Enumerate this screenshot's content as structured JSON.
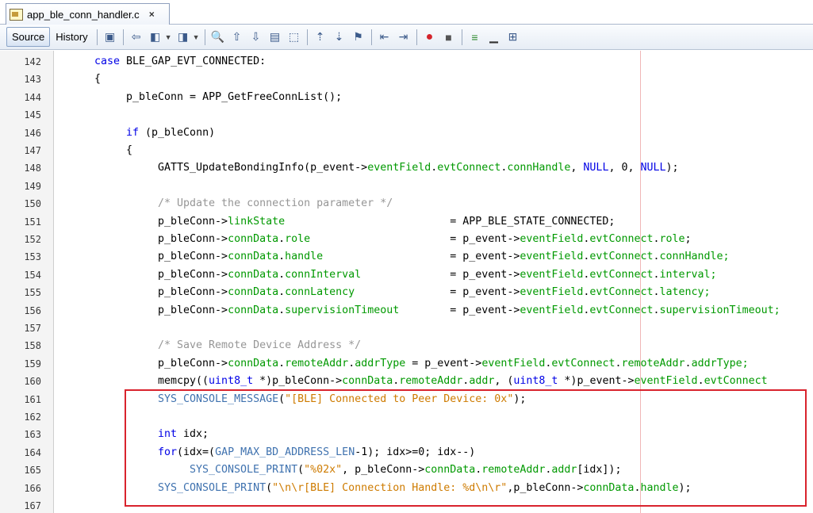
{
  "tab": {
    "filename": "app_ble_conn_handler.c",
    "close": "×"
  },
  "toolbar": {
    "source": "Source",
    "history": "History"
  },
  "line_numbers": [
    "142",
    "143",
    "144",
    "145",
    "146",
    "147",
    "148",
    "149",
    "150",
    "151",
    "152",
    "153",
    "154",
    "155",
    "156",
    "157",
    "158",
    "159",
    "160",
    "161",
    "162",
    "163",
    "164",
    "165",
    "166",
    "167"
  ],
  "lines": [
    {
      "indent": 4,
      "tokens": [
        {
          "t": "case ",
          "c": "kw"
        },
        {
          "t": "BLE_GAP_EVT_CONNECTED:"
        }
      ]
    },
    {
      "indent": 4,
      "tokens": [
        {
          "t": "{"
        }
      ]
    },
    {
      "indent": 8,
      "tokens": [
        {
          "t": "p_bleConn = APP_GetFreeConnList();"
        }
      ]
    },
    {
      "indent": 0,
      "tokens": []
    },
    {
      "indent": 8,
      "tokens": [
        {
          "t": "if",
          "c": "kw"
        },
        {
          "t": " (p_bleConn)"
        }
      ]
    },
    {
      "indent": 8,
      "tokens": [
        {
          "t": "{"
        }
      ]
    },
    {
      "indent": 12,
      "tokens": [
        {
          "t": "GATTS_UpdateBondingInfo(p_event->"
        },
        {
          "t": "eventField",
          "c": "fld"
        },
        {
          "t": "."
        },
        {
          "t": "evtConnect",
          "c": "fld"
        },
        {
          "t": "."
        },
        {
          "t": "connHandle",
          "c": "fld"
        },
        {
          "t": ", "
        },
        {
          "t": "NULL",
          "c": "kw"
        },
        {
          "t": ", 0, "
        },
        {
          "t": "NULL",
          "c": "kw"
        },
        {
          "t": ");"
        }
      ]
    },
    {
      "indent": 0,
      "tokens": []
    },
    {
      "indent": 12,
      "tokens": [
        {
          "t": "/* Update the connection parameter */",
          "c": "cmt"
        }
      ]
    },
    {
      "indent": 12,
      "tokens": [
        {
          "t": "p_bleConn->"
        },
        {
          "t": "linkState",
          "c": "fld"
        },
        {
          "t": "                          = APP_BLE_STATE_CONNECTED;"
        }
      ]
    },
    {
      "indent": 12,
      "tokens": [
        {
          "t": "p_bleConn->"
        },
        {
          "t": "connData",
          "c": "fld"
        },
        {
          "t": "."
        },
        {
          "t": "role",
          "c": "fld"
        },
        {
          "t": "                      = p_event->"
        },
        {
          "t": "eventField",
          "c": "fld"
        },
        {
          "t": "."
        },
        {
          "t": "evtConnect",
          "c": "fld"
        },
        {
          "t": "."
        },
        {
          "t": "role",
          "c": "fld"
        },
        {
          "t": ";"
        }
      ]
    },
    {
      "indent": 12,
      "tokens": [
        {
          "t": "p_bleConn->"
        },
        {
          "t": "connData",
          "c": "fld"
        },
        {
          "t": "."
        },
        {
          "t": "handle",
          "c": "fld"
        },
        {
          "t": "                    = p_event->"
        },
        {
          "t": "eventField",
          "c": "fld"
        },
        {
          "t": "."
        },
        {
          "t": "evtConnect",
          "c": "fld"
        },
        {
          "t": "."
        },
        {
          "t": "connHandle;",
          "c": "fld"
        }
      ]
    },
    {
      "indent": 12,
      "tokens": [
        {
          "t": "p_bleConn->"
        },
        {
          "t": "connData",
          "c": "fld"
        },
        {
          "t": "."
        },
        {
          "t": "connInterval",
          "c": "fld"
        },
        {
          "t": "              = p_event->"
        },
        {
          "t": "eventField",
          "c": "fld"
        },
        {
          "t": "."
        },
        {
          "t": "evtConnect",
          "c": "fld"
        },
        {
          "t": "."
        },
        {
          "t": "interval;",
          "c": "fld"
        }
      ]
    },
    {
      "indent": 12,
      "tokens": [
        {
          "t": "p_bleConn->"
        },
        {
          "t": "connData",
          "c": "fld"
        },
        {
          "t": "."
        },
        {
          "t": "connLatency",
          "c": "fld"
        },
        {
          "t": "               = p_event->"
        },
        {
          "t": "eventField",
          "c": "fld"
        },
        {
          "t": "."
        },
        {
          "t": "evtConnect",
          "c": "fld"
        },
        {
          "t": "."
        },
        {
          "t": "latency;",
          "c": "fld"
        }
      ]
    },
    {
      "indent": 12,
      "tokens": [
        {
          "t": "p_bleConn->"
        },
        {
          "t": "connData",
          "c": "fld"
        },
        {
          "t": "."
        },
        {
          "t": "supervisionTimeout",
          "c": "fld"
        },
        {
          "t": "        = p_event->"
        },
        {
          "t": "eventField",
          "c": "fld"
        },
        {
          "t": "."
        },
        {
          "t": "evtConnect",
          "c": "fld"
        },
        {
          "t": "."
        },
        {
          "t": "supervisionTimeout;",
          "c": "fld"
        }
      ]
    },
    {
      "indent": 0,
      "tokens": []
    },
    {
      "indent": 12,
      "tokens": [
        {
          "t": "/* Save Remote Device Address */",
          "c": "cmt"
        }
      ]
    },
    {
      "indent": 12,
      "tokens": [
        {
          "t": "p_bleConn->"
        },
        {
          "t": "connData",
          "c": "fld"
        },
        {
          "t": "."
        },
        {
          "t": "remoteAddr",
          "c": "fld"
        },
        {
          "t": "."
        },
        {
          "t": "addrType",
          "c": "fld"
        },
        {
          "t": " = p_event->"
        },
        {
          "t": "eventField",
          "c": "fld"
        },
        {
          "t": "."
        },
        {
          "t": "evtConnect",
          "c": "fld"
        },
        {
          "t": "."
        },
        {
          "t": "remoteAddr",
          "c": "fld"
        },
        {
          "t": "."
        },
        {
          "t": "addrType;",
          "c": "fld"
        }
      ]
    },
    {
      "indent": 12,
      "tokens": [
        {
          "t": "memcpy(("
        },
        {
          "t": "uint8_t",
          "c": "kw"
        },
        {
          "t": " *)p_bleConn->"
        },
        {
          "t": "connData",
          "c": "fld"
        },
        {
          "t": "."
        },
        {
          "t": "remoteAddr",
          "c": "fld"
        },
        {
          "t": "."
        },
        {
          "t": "addr",
          "c": "fld"
        },
        {
          "t": ", ("
        },
        {
          "t": "uint8_t",
          "c": "kw"
        },
        {
          "t": " *)p_event->"
        },
        {
          "t": "eventField",
          "c": "fld"
        },
        {
          "t": "."
        },
        {
          "t": "evtConnect",
          "c": "fld"
        }
      ]
    },
    {
      "indent": 12,
      "tokens": [
        {
          "t": "SYS_CONSOLE_MESSAGE",
          "c": "mac"
        },
        {
          "t": "("
        },
        {
          "t": "\"[BLE] Connected to Peer Device: 0x\"",
          "c": "str"
        },
        {
          "t": ");"
        }
      ]
    },
    {
      "indent": 0,
      "tokens": []
    },
    {
      "indent": 12,
      "tokens": [
        {
          "t": "int",
          "c": "kw"
        },
        {
          "t": " idx;"
        }
      ]
    },
    {
      "indent": 12,
      "tokens": [
        {
          "t": "for",
          "c": "kw"
        },
        {
          "t": "(idx=("
        },
        {
          "t": "GAP_MAX_BD_ADDRESS_LEN",
          "c": "mac"
        },
        {
          "t": "-1); idx>=0; idx--)"
        }
      ]
    },
    {
      "indent": 16,
      "tokens": [
        {
          "t": "SYS_CONSOLE_PRINT",
          "c": "mac"
        },
        {
          "t": "("
        },
        {
          "t": "\"%02x\"",
          "c": "str"
        },
        {
          "t": ", p_bleConn->"
        },
        {
          "t": "connData",
          "c": "fld"
        },
        {
          "t": "."
        },
        {
          "t": "remoteAddr",
          "c": "fld"
        },
        {
          "t": "."
        },
        {
          "t": "addr",
          "c": "fld"
        },
        {
          "t": "[idx]);"
        }
      ]
    },
    {
      "indent": 12,
      "tokens": [
        {
          "t": "SYS_CONSOLE_PRINT",
          "c": "mac"
        },
        {
          "t": "("
        },
        {
          "t": "\"\\n\\r[BLE] Connection Handle: %d\\n\\r\"",
          "c": "str"
        },
        {
          "t": ",p_bleConn->"
        },
        {
          "t": "connData",
          "c": "fld"
        },
        {
          "t": "."
        },
        {
          "t": "handle",
          "c": "fld"
        },
        {
          "t": ");"
        }
      ]
    },
    {
      "indent": 0,
      "tokens": []
    }
  ]
}
